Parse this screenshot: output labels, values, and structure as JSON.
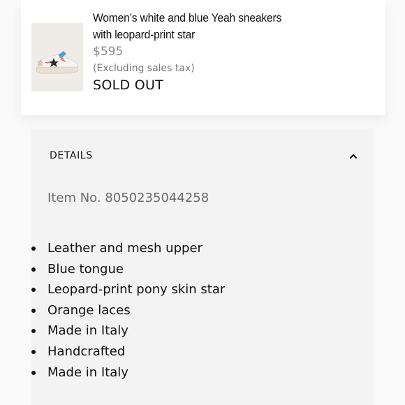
{
  "product": {
    "title_line1": "Women’s white and blue Yeah sneakers",
    "title_line2": "with leopard-print star",
    "price": "$595",
    "tax_note": "(Excluding sales tax)",
    "stock_status": "SOLD OUT",
    "thumbnail_icon": "sneaker-image"
  },
  "details": {
    "header": "DETAILS",
    "toggle_icon": "chevron-up-icon",
    "item_number": "Item No. 8050235044258",
    "features": [
      "Leather and mesh upper",
      "Blue tongue",
      "Leopard-print pony skin star",
      "Orange laces",
      "Made in Italy",
      "Handcrafted",
      "Made in Italy"
    ]
  }
}
